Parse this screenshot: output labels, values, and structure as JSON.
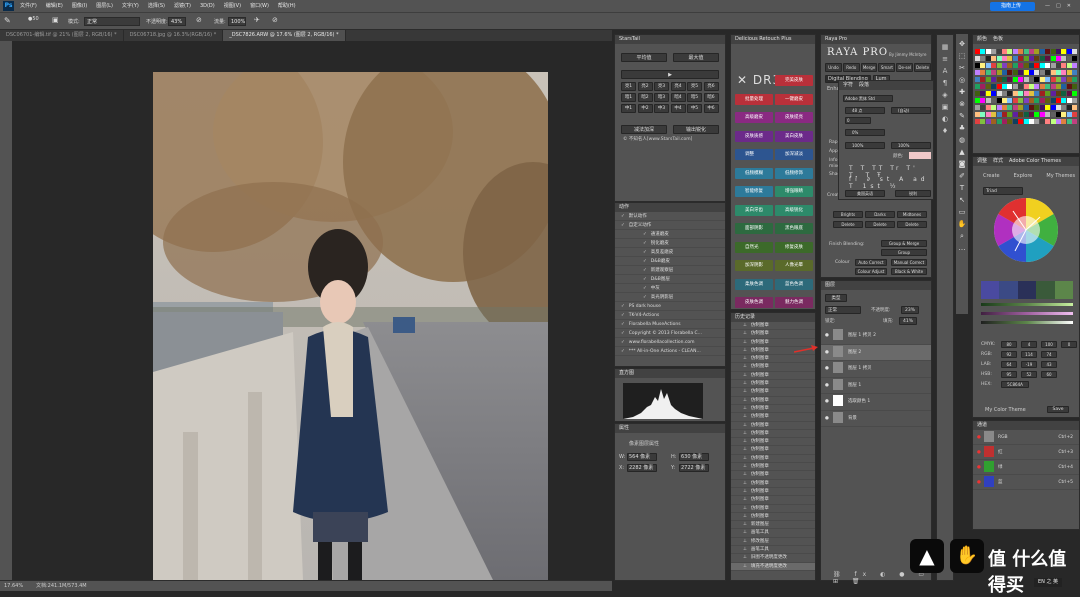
{
  "app": {
    "logo": "Ps",
    "share_label": "指南上传"
  },
  "menu": [
    "文件(F)",
    "编辑(E)",
    "图像(I)",
    "图层(L)",
    "文字(Y)",
    "选择(S)",
    "滤镜(T)",
    "3D(D)",
    "视图(V)",
    "窗口(W)",
    "帮助(H)"
  ],
  "options": {
    "mode_label": "模式:",
    "mode_value": "正常",
    "opacity_label": "不透明度:",
    "opacity_value": "43%",
    "flow_label": "流量:",
    "flow_value": "100%",
    "brush_size": "50"
  },
  "tabs": [
    {
      "label": "DSC06701-编辑.tif @ 21% (图层 2, RGB/16) *"
    },
    {
      "label": "DSC06718.jpg @ 16.3%(RGB/16) *"
    },
    {
      "label": "_DSC7826.ARW @ 17.6% (图层 2, RGB/16) *"
    }
  ],
  "status": {
    "zoom": "17.64%",
    "doc": "文档:241.1M/573.4M"
  },
  "starstail": {
    "title": "StarsTail",
    "btn_flatten": "平均值",
    "btn_max": "最大值",
    "btn_play": "▶",
    "brights": [
      "亮1",
      "亮2",
      "亮3",
      "亮4",
      "亮5",
      "亮6"
    ],
    "darks": [
      "暗1",
      "暗2",
      "暗3",
      "暗4",
      "暗5",
      "暗6"
    ],
    "mids": [
      "中1",
      "中2",
      "中3",
      "中4",
      "中5",
      "中6"
    ],
    "btn_reduce": "减法加深",
    "btn_output": "输出锐化",
    "footer": "© 不知名人[www.StarsTail.com]"
  },
  "dr3": {
    "title": "Delicious Retouch Plus",
    "logo": "DR3",
    "buttons": [
      {
        "label": "完美皮肤",
        "color": "#b9303a"
      },
      {
        "label": "批量处理",
        "color": "#b9303a"
      },
      {
        "label": "一键磨皮",
        "color": "#b9303a"
      },
      {
        "label": "高级磨皮",
        "color": "#8a2a82"
      },
      {
        "label": "皮肤提亮",
        "color": "#8a2a82"
      },
      {
        "label": "皮肤质感",
        "color": "#6c2a8a"
      },
      {
        "label": "美白皮肤",
        "color": "#6c2a8a"
      },
      {
        "label": "调整",
        "color": "#2d5590"
      },
      {
        "label": "加深减淡",
        "color": "#2d5590"
      },
      {
        "label": "低频模糊",
        "color": "#2d7a9a"
      },
      {
        "label": "低频修饰",
        "color": "#2d7a9a"
      },
      {
        "label": "智能修复",
        "color": "#2d7a9a"
      },
      {
        "label": "增强眼睛",
        "color": "#2d8a6a"
      },
      {
        "label": "美白牙齿",
        "color": "#2d8a6a"
      },
      {
        "label": "高级锐化",
        "color": "#2d8a6a"
      },
      {
        "label": "面部阴影",
        "color": "#2d6a40"
      },
      {
        "label": "黑色眼底",
        "color": "#2d6a40"
      },
      {
        "label": "自然光",
        "color": "#3c6a2a"
      },
      {
        "label": "修复皮肤",
        "color": "#3c6a2a"
      },
      {
        "label": "加深阴影",
        "color": "#5a6a2a"
      },
      {
        "label": "人像光晕",
        "color": "#5a6a2a"
      },
      {
        "label": "柔肤色调",
        "color": "#2d6a7a"
      },
      {
        "label": "蓝色色调",
        "color": "#2d6a7a"
      },
      {
        "label": "皮肤色调",
        "color": "#7a2a60"
      },
      {
        "label": "魅力色调",
        "color": "#7a2a60"
      }
    ]
  },
  "actions": {
    "title": "动作",
    "items": [
      "默认动作",
      "自定义动作",
      "通道磨皮",
      "锐化磨皮",
      "高反差磨皮",
      "D&B磨皮",
      "新建观察层",
      "D&B图层",
      "中灰",
      "高光阴影层",
      "PS dark house",
      "TK-V4-Actions",
      "Florabella MuseActions",
      "Copyright © 2013 Florabella C...",
      "www.florabellacollection.com",
      "*** All-in-One Actions - CLEAN..."
    ]
  },
  "histogram": {
    "title": "直方图"
  },
  "properties": {
    "title": "属性",
    "subtitle": "像素图层属性",
    "w_label": "W:",
    "w_value": "564 像素",
    "h_label": "H:",
    "h_value": "630 像素",
    "x_label": "X:",
    "x_value": "2282 像素",
    "y_label": "Y:",
    "y_value": "2722 像素"
  },
  "history": {
    "title": "历史记录",
    "items": [
      "仿制图章",
      "仿制图章",
      "仿制图章",
      "仿制图章",
      "仿制图章",
      "仿制图章",
      "仿制图章",
      "仿制图章",
      "仿制图章",
      "仿制图章",
      "仿制图章",
      "仿制图章",
      "仿制图章",
      "仿制图章",
      "仿制图章",
      "仿制图章",
      "仿制图章",
      "仿制图章",
      "仿制图章",
      "仿制图章",
      "仿制图章",
      "仿制图章",
      "仿制图章",
      "仿制图章",
      "新建图层",
      "画笔工具",
      "修改图层",
      "画笔工具",
      "旧图不透明度更改",
      "填充不透明度更改"
    ]
  },
  "rayapro": {
    "title": "Raya Pro",
    "logo": "RAYA PRO",
    "byline": "By Jimmy McIntyre",
    "top_buttons": [
      "Undo",
      "Redo",
      "Merge",
      "Smart",
      "De-sel",
      "Delete"
    ],
    "tabs": [
      "Digital Blending",
      "Lum"
    ],
    "enhance_label": "Enhance",
    "rapid_label": "Rapid",
    "apply_label": "Apply",
    "info_label": "Info a",
    "mixed_label": "mixed",
    "shadows_label": "Shadow",
    "create_label": "Create",
    "mid_buttons": [
      "Brights",
      "Darks",
      "Midtones",
      "Delete",
      "Delete",
      "Delete"
    ],
    "blending_label": "Finish Blending:",
    "group_merge": "Group & Merge",
    "group": "Group",
    "colour_label": "Colour",
    "auto_correct": "Auto Correct",
    "manual_correct": "Manual Correct",
    "colour_adjust": "Colour Adjust",
    "black_white": "Black & White"
  },
  "character": {
    "title": "字符",
    "tab2": "段落",
    "font": "Adobe 黑体 Std",
    "size": "48 点",
    "leading": "(自动)",
    "tracking": "0%",
    "scale_v": "100%",
    "scale_h": "100%",
    "color_label": "颜色:",
    "lang": "美国英语",
    "aa": "锐利",
    "tracking_v": "0"
  },
  "layers": {
    "title": "图层",
    "kind_label": "类型",
    "blend": "正常",
    "opacity_label": "不透明度:",
    "opacity": "23%",
    "lock_label": "锁定:",
    "fill_label": "填充:",
    "fill": "41%",
    "rows": [
      {
        "name": "图层 1 拷贝 2"
      },
      {
        "name": "图层 2"
      },
      {
        "name": "图层 1 拷贝"
      },
      {
        "name": "图层 1"
      },
      {
        "name": "选取颜色 1"
      },
      {
        "name": "背景"
      }
    ]
  },
  "swatches": {
    "title": "颜色",
    "tab2": "色板"
  },
  "colorthemes": {
    "tab1": "调整",
    "tab2": "样式",
    "tab3": "Adobe Color Themes",
    "create": "Create",
    "explore": "Explore",
    "mythemes": "My Themes",
    "rule": "Triad",
    "readouts": [
      {
        "label": "CMYK:",
        "values": [
          "80",
          "4",
          "100",
          "0"
        ]
      },
      {
        "label": "RGB:",
        "values": [
          "92",
          "114",
          "74"
        ]
      },
      {
        "label": "LAB:",
        "values": [
          "64",
          "-19",
          "43"
        ]
      },
      {
        "label": "HSB:",
        "values": [
          "95",
          "52",
          "60"
        ]
      },
      {
        "label": "HEX:",
        "values": [
          "5C864A"
        ]
      }
    ],
    "theme_name": "My Color Theme",
    "save": "Save"
  },
  "channels": {
    "title": "通道",
    "rows": [
      {
        "name": "RGB",
        "key": "Ctrl+2"
      },
      {
        "name": "红",
        "key": "Ctrl+3"
      },
      {
        "name": "绿",
        "key": "Ctrl+4"
      },
      {
        "name": "蓝",
        "key": "Ctrl+5"
      }
    ]
  },
  "taskbar": {
    "ime": "EN 之 英"
  }
}
